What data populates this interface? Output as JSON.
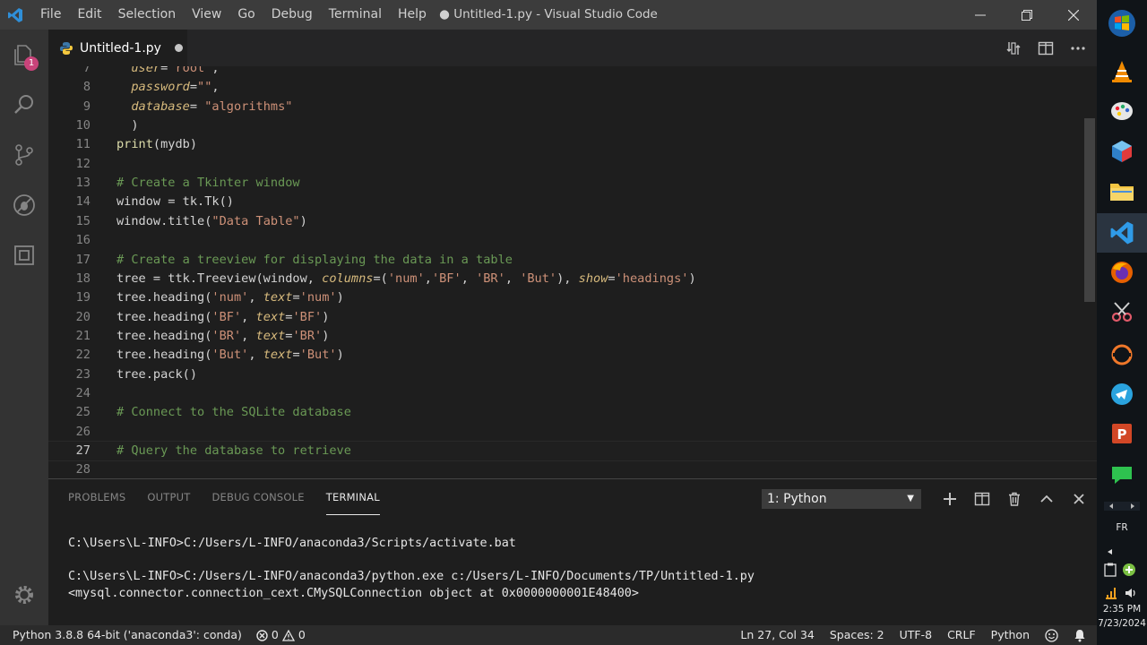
{
  "window": {
    "title": "● Untitled-1.py - Visual Studio Code",
    "menu": [
      "File",
      "Edit",
      "Selection",
      "View",
      "Go",
      "Debug",
      "Terminal",
      "Help"
    ]
  },
  "activity_bar": {
    "items": [
      "files-icon",
      "search-icon",
      "source-control-icon",
      "debug-icon",
      "extensions-icon"
    ],
    "badge": "1"
  },
  "tab": {
    "label": "Untitled-1.py",
    "modified": true
  },
  "editor": {
    "lines": [
      {
        "n": "7",
        "html": "  <span class='t-param'>user</span>=<span class='t-str'>\"root\"</span>,"
      },
      {
        "n": "8",
        "html": "  <span class='t-param'>password</span>=<span class='t-str'>\"\"</span>,"
      },
      {
        "n": "9",
        "html": "  <span class='t-param'>database</span>= <span class='t-str'>\"algorithms\"</span>"
      },
      {
        "n": "10",
        "html": "  )"
      },
      {
        "n": "11",
        "html": "<span class='t-fn'>print</span>(mydb)"
      },
      {
        "n": "12",
        "html": ""
      },
      {
        "n": "13",
        "html": "<span class='t-comment'># Create a Tkinter window</span>"
      },
      {
        "n": "14",
        "html": "window = tk.Tk()"
      },
      {
        "n": "15",
        "html": "window.title(<span class='t-str'>\"Data Table\"</span>)"
      },
      {
        "n": "16",
        "html": ""
      },
      {
        "n": "17",
        "html": "<span class='t-comment'># Create a treeview for displaying the data in a table</span>"
      },
      {
        "n": "18",
        "html": "tree = ttk.Treeview(window, <span class='t-param'>columns</span>=(<span class='t-str'>'num'</span>,<span class='t-str'>'BF'</span>, <span class='t-str'>'BR'</span>, <span class='t-str'>'But'</span>), <span class='t-param'>show</span>=<span class='t-str'>'headings'</span>)"
      },
      {
        "n": "19",
        "html": "tree.heading(<span class='t-str'>'num'</span>, <span class='t-param'>text</span>=<span class='t-str'>'num'</span>)"
      },
      {
        "n": "20",
        "html": "tree.heading(<span class='t-str'>'BF'</span>, <span class='t-param'>text</span>=<span class='t-str'>'BF'</span>)"
      },
      {
        "n": "21",
        "html": "tree.heading(<span class='t-str'>'BR'</span>, <span class='t-param'>text</span>=<span class='t-str'>'BR'</span>)"
      },
      {
        "n": "22",
        "html": "tree.heading(<span class='t-str'>'But'</span>, <span class='t-param'>text</span>=<span class='t-str'>'But'</span>)"
      },
      {
        "n": "23",
        "html": "tree.pack()"
      },
      {
        "n": "24",
        "html": ""
      },
      {
        "n": "25",
        "html": "<span class='t-comment'># Connect to the SQLite database</span>"
      },
      {
        "n": "26",
        "html": ""
      },
      {
        "n": "27",
        "html": "<span class='t-comment'># Query the database to retrieve</span>"
      },
      {
        "n": "28",
        "html": ""
      }
    ],
    "active_line": "27"
  },
  "panel": {
    "tabs": [
      "PROBLEMS",
      "OUTPUT",
      "DEBUG CONSOLE",
      "TERMINAL"
    ],
    "active_tab": "TERMINAL",
    "terminal_select": "1: Python",
    "terminal_lines": [
      "C:\\Users\\L-INFO>C:/Users/L-INFO/anaconda3/Scripts/activate.bat",
      "",
      "C:\\Users\\L-INFO>C:/Users/L-INFO/anaconda3/python.exe c:/Users/L-INFO/Documents/TP/Untitled-1.py",
      "<mysql.connector.connection_cext.CMySQLConnection object at 0x0000000001E48400>"
    ]
  },
  "status_bar": {
    "interpreter": "Python 3.8.8 64-bit ('anaconda3': conda)",
    "errors": "0",
    "warnings": "0",
    "position": "Ln 27, Col 34",
    "spaces": "Spaces: 2",
    "encoding": "UTF-8",
    "eol": "CRLF",
    "language": "Python"
  },
  "taskbar": {
    "lang": "FR",
    "time": "2:35 PM",
    "date": "7/23/2024"
  }
}
